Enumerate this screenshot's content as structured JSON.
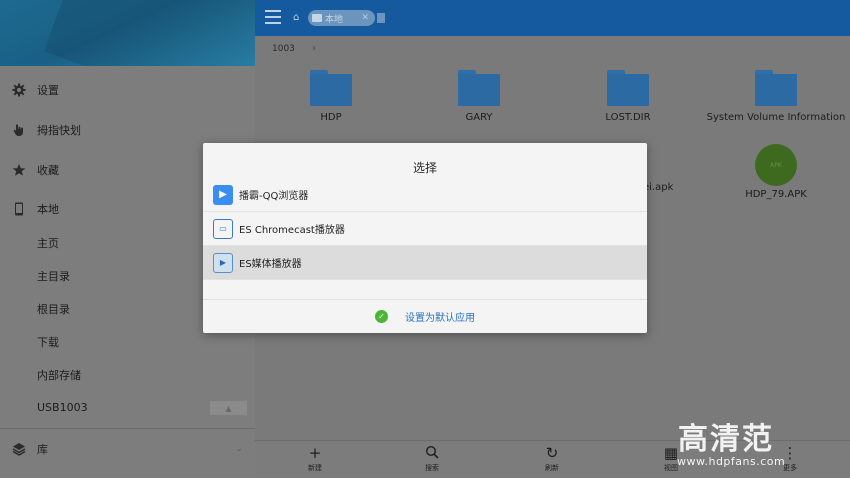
{
  "sidebar": {
    "items": [
      {
        "label": "设置",
        "icon": "gear-icon"
      },
      {
        "label": "拇指快划",
        "icon": "hand-pointer-icon"
      },
      {
        "label": "收藏",
        "icon": "star-icon"
      },
      {
        "label": "本地",
        "icon": "phone-icon"
      }
    ],
    "sub_items": [
      "主页",
      "主目录",
      "根目录",
      "下载",
      "内部存储",
      "USB1003"
    ],
    "library_label": "库",
    "library_icon": "layers-icon"
  },
  "header": {
    "tab_label": "本地",
    "menu_icon": "hamburger-menu-icon",
    "home_icon": "home-icon"
  },
  "breadcrumb": {
    "current": "1003"
  },
  "files": [
    {
      "name": "HDP",
      "type": "folder"
    },
    {
      "name": "GARY",
      "type": "folder"
    },
    {
      "name": "LOST.DIR",
      "type": "folder"
    },
    {
      "name": "System Volume Information",
      "type": "folder"
    },
    {
      "name": "ngbei.apk",
      "type": "apk"
    },
    {
      "name": "HDP_79.APK",
      "type": "apk",
      "badge": "APK"
    }
  ],
  "dialog": {
    "title": "选择",
    "options": [
      {
        "label": "播霸-QQ浏览器",
        "icon": "play-icon"
      },
      {
        "label": "ES Chromecast播放器",
        "icon": "cast-icon"
      },
      {
        "label": "ES媒体播放器",
        "icon": "video-icon",
        "selected": true
      }
    ],
    "set_default_label": "设置为默认应用"
  },
  "toolbar": {
    "new_label": "新建",
    "search_label": "搜索",
    "refresh_label": "刷新",
    "view_label": "视图",
    "more_label": "更多"
  },
  "watermark": {
    "logo": "高清范",
    "url": "www.hdpfans.com"
  },
  "colors": {
    "appbar": "#155a9e",
    "dialog_accent": "#2a73c4",
    "check_green": "#4cb634"
  }
}
